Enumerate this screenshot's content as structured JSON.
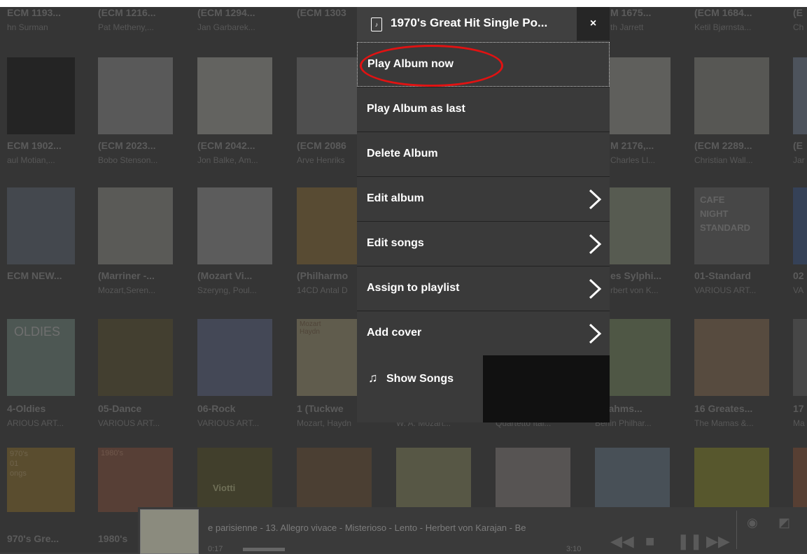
{
  "albums_row1": [
    {
      "title": "ECM 1193...",
      "artist": "hn Surman"
    },
    {
      "title": "(ECM 1216...",
      "artist": "Pat Metheny,..."
    },
    {
      "title": "(ECM 1294...",
      "artist": "Jan Garbarek..."
    },
    {
      "title": "(ECM 1303",
      "artist": ""
    },
    {
      "title": "M 1675...",
      "artist": "th Jarrett"
    },
    {
      "title": "(ECM 1684...",
      "artist": "Ketil Bjørnsta..."
    },
    {
      "title": "(E",
      "artist": "Ch"
    }
  ],
  "albums_row2": [
    {
      "title": "ECM 1902...",
      "artist": "aul Motian,..."
    },
    {
      "title": "(ECM 2023...",
      "artist": "Bobo Stenson..."
    },
    {
      "title": "(ECM 2042...",
      "artist": "Jon Balke, Am..."
    },
    {
      "title": "(ECM 2086",
      "artist": "Arve Henriks"
    },
    {
      "title": "M 2176,...",
      "artist": "Charles Ll..."
    },
    {
      "title": "(ECM 2289...",
      "artist": "Christian Wall..."
    },
    {
      "title": "(E",
      "artist": "Jar"
    }
  ],
  "albums_row3": [
    {
      "title": "ECM NEW...",
      "artist": ""
    },
    {
      "title": "(Marriner -...",
      "artist": "Mozart,Seren..."
    },
    {
      "title": "(Mozart Vi...",
      "artist": "Szeryng, Poul..."
    },
    {
      "title": "(Philharmo",
      "artist": "14CD Antal D"
    },
    {
      "title": "es Sylphi...",
      "artist": "rbert von K..."
    },
    {
      "title": "01-Standard",
      "artist": "VARIOUS ART..."
    },
    {
      "title": "02",
      "artist": "VA"
    }
  ],
  "albums_row4": [
    {
      "title": "4-Oldies",
      "artist": "ARIOUS ART..."
    },
    {
      "title": "05-Dance",
      "artist": "VARIOUS ART..."
    },
    {
      "title": "06-Rock",
      "artist": "VARIOUS ART..."
    },
    {
      "title": "1 (Tuckwe",
      "artist": "Mozart, Haydn"
    },
    {
      "title": "",
      "artist": "W. A. Mozart..."
    },
    {
      "title": "",
      "artist": "Quartetto Ital..."
    },
    {
      "title": ".Brahms...",
      "artist": "Berlin Philhar..."
    },
    {
      "title": "16 Greates...",
      "artist": "The Mamas &..."
    },
    {
      "title": "17",
      "artist": "Ma"
    }
  ],
  "albums_row5": [
    {
      "title": "970's Gre...",
      "artist": ""
    },
    {
      "title": "1980's",
      "artist": ""
    }
  ],
  "cover_texts": {
    "cafe": [
      "CAFE",
      "NIGHT",
      "STANDARD"
    ],
    "viotti": "Viotti",
    "mozart": "Mozart",
    "haydn": "Haydn",
    "oldies": "OLDIES",
    "seventies": [
      "970's",
      "01",
      "ongs"
    ],
    "eighties": [
      "1980's"
    ]
  },
  "menu": {
    "title": "1970's Great Hit Single Po...",
    "close": "×",
    "items": [
      {
        "label": "Play Album now",
        "has_arrow": false
      },
      {
        "label": "Play Album as last",
        "has_arrow": false
      },
      {
        "label": "Delete Album",
        "has_arrow": false
      },
      {
        "label": "Edit album",
        "has_arrow": true
      },
      {
        "label": "Edit songs",
        "has_arrow": true
      },
      {
        "label": "Assign to playlist",
        "has_arrow": true
      },
      {
        "label": "Add cover",
        "has_arrow": true
      }
    ],
    "show_songs": "Show Songs"
  },
  "player": {
    "marquee": "e parisienne - 13. Allegro vivace - Misterioso - Lento - Herbert von Karajan - Be",
    "elapsed": "0:17",
    "total": "3:10"
  },
  "colors": {
    "highlight": "#e11212",
    "menu_bg": "#3a3a3a"
  }
}
